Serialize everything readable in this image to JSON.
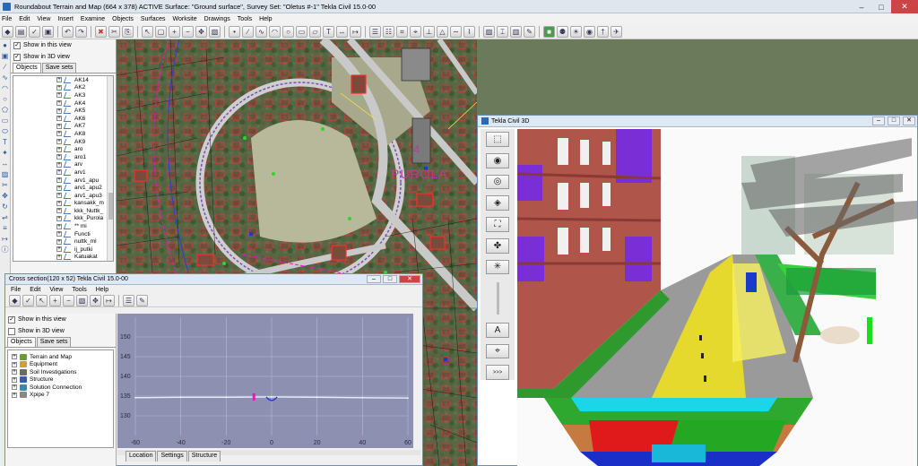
{
  "app": {
    "title": "Roundabout  Terrain and Map (664 x 378)   ACTIVE Surface: \"Ground surface\", Survey Set: \"Oletus #-1\"   Tekla Civil 15.0-00",
    "menu": [
      "File",
      "Edit",
      "View",
      "Insert",
      "Examine",
      "Objects",
      "Surfaces",
      "Worksite",
      "Drawings",
      "Tools",
      "Help"
    ]
  },
  "object_panel": {
    "show_in_view": "Show in this view",
    "show_in_3d": "Show in 3D view",
    "tabs": [
      "Objects",
      "Save sets"
    ],
    "tree": [
      {
        "label": "AK14"
      },
      {
        "label": "AK2"
      },
      {
        "label": "AK3"
      },
      {
        "label": "AK4"
      },
      {
        "label": "AK5"
      },
      {
        "label": "AK6"
      },
      {
        "label": "AK7"
      },
      {
        "label": "AK8"
      },
      {
        "label": "AK9"
      },
      {
        "label": "aro"
      },
      {
        "label": "aro1"
      },
      {
        "label": "arv"
      },
      {
        "label": "arv1"
      },
      {
        "label": "arv1_apu"
      },
      {
        "label": "arv1_apu2"
      },
      {
        "label": "arv1_apu3"
      },
      {
        "label": "kansakk_m"
      },
      {
        "label": "kkk_Nuttk_"
      },
      {
        "label": "kkk_Purola"
      },
      {
        "label": "** mi"
      },
      {
        "label": "Functi"
      },
      {
        "label": "nuttk_ml"
      },
      {
        "label": "ij_putki"
      },
      {
        "label": "Katuakat"
      }
    ]
  },
  "map": {
    "label": "PUROLA",
    "number": "4"
  },
  "view3d": {
    "title": "Tekla Civil 3D",
    "text_button": "A",
    "more_button": ">>>"
  },
  "cross_section": {
    "title": "Cross section(120 x 52)   Tekla Civil 15.0-00",
    "menu": [
      "File",
      "Edit",
      "View",
      "Tools",
      "Help"
    ],
    "show_in_view": "Show in this view",
    "show_in_3d": "Show in 3D view",
    "tabs": [
      "Objects",
      "Save sets"
    ],
    "tree": [
      {
        "label": "Terrain and Map",
        "color": "#6a9a3a"
      },
      {
        "label": "Equipment",
        "color": "#c8a040"
      },
      {
        "label": "Soil Investigations",
        "color": "#6a6a6a"
      },
      {
        "label": "Structure",
        "color": "#3a5ab0"
      },
      {
        "label": "Solution Connection",
        "color": "#3a8ab0"
      },
      {
        "label": "Xpipe 7",
        "color": "#888888"
      }
    ],
    "bottom_tabs": [
      "Location",
      "Settings",
      "Structure"
    ]
  },
  "chart_data": {
    "type": "line",
    "title": "",
    "xlabel": "",
    "ylabel": "",
    "xlim": [
      -60,
      60
    ],
    "ylim": [
      125,
      155
    ],
    "x_ticks": [
      -60,
      -40,
      -20,
      0,
      20,
      40,
      60
    ],
    "y_ticks": [
      130,
      135,
      140,
      145,
      150
    ],
    "series": [
      {
        "values": [
          [
            -60,
            134.6
          ],
          [
            -40,
            134.7
          ],
          [
            -20,
            134.7
          ],
          [
            0,
            134.8
          ],
          [
            20,
            134.7
          ],
          [
            40,
            134.6
          ],
          [
            60,
            134.5
          ]
        ]
      }
    ]
  }
}
